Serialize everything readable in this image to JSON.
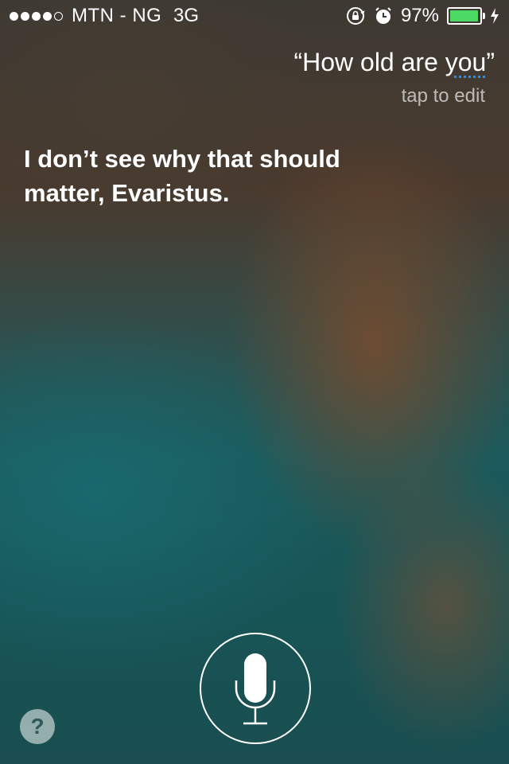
{
  "status_bar": {
    "carrier": "MTN - NG",
    "network": "3G",
    "battery_percent": "97%",
    "battery_level": 0.97,
    "signal_bars_filled": 4,
    "signal_bars_total": 5
  },
  "siri": {
    "query_prefix": "“How old are ",
    "query_underlined": "you",
    "query_suffix": "”",
    "tap_to_edit": "tap to edit",
    "response": "I don’t see why that should matter, Evaristus."
  },
  "help_button": {
    "label": "?"
  },
  "colors": {
    "battery_fill": "#4cd964",
    "underline": "#1e90ff"
  },
  "icons": [
    "rotation-lock-icon",
    "alarm-icon",
    "charging-icon",
    "microphone-icon"
  ]
}
